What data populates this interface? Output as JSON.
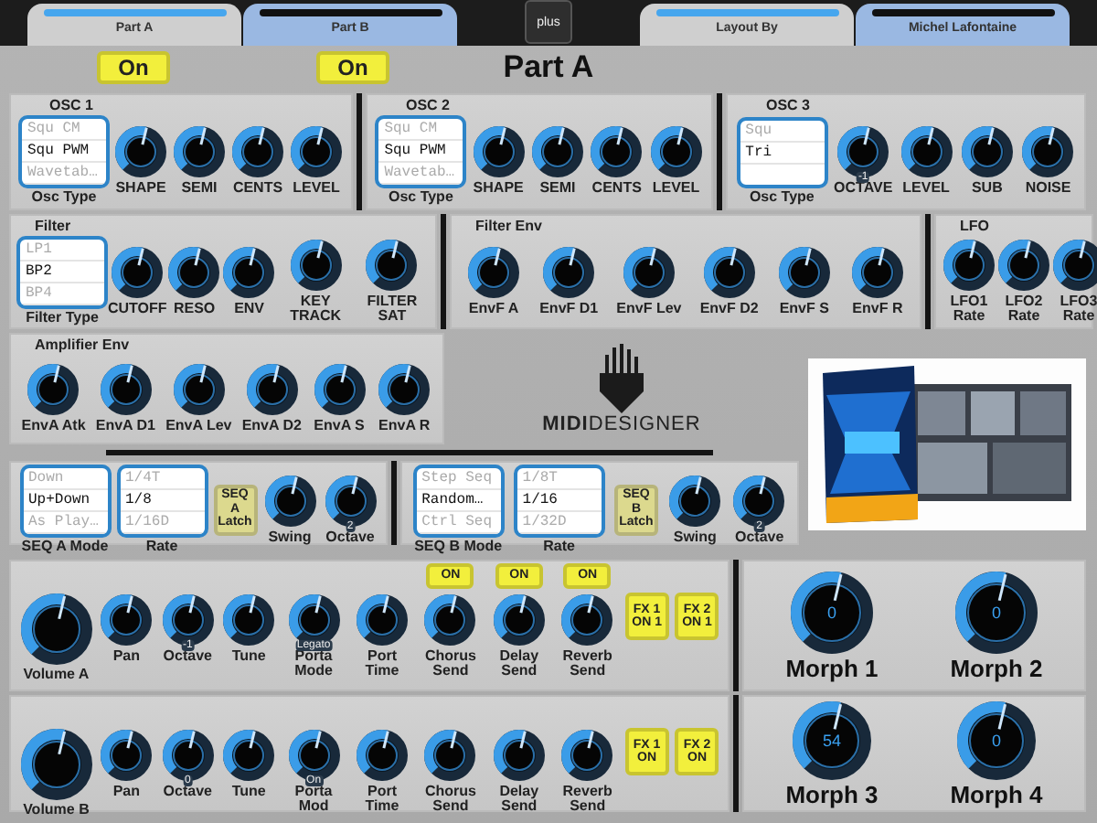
{
  "top_tabs": [
    {
      "label": "Part A",
      "lit": true
    },
    {
      "label": "Part B",
      "lit": false
    }
  ],
  "plus_button": "plus",
  "info_tabs": [
    {
      "label": "Layout By",
      "lit": true
    },
    {
      "label": "Michel Lafontaine",
      "lit": false
    }
  ],
  "part_switches": [
    {
      "label": "On",
      "on": true
    },
    {
      "label": "On",
      "on": true
    }
  ],
  "title": "Part A",
  "oscillators": [
    {
      "title": "OSC 1",
      "controls": [
        {
          "kind": "list",
          "label": "Osc Type",
          "options": [
            {
              "text": "Squ CM",
              "selected": false
            },
            {
              "text": "Squ PWM",
              "selected": true
            },
            {
              "text": "Wavetab…",
              "selected": false
            }
          ]
        },
        {
          "kind": "knob",
          "label": "SHAPE"
        },
        {
          "kind": "knob",
          "label": "SEMI"
        },
        {
          "kind": "knob",
          "label": "CENTS"
        },
        {
          "kind": "knob",
          "label": "LEVEL"
        }
      ]
    },
    {
      "title": "OSC 2",
      "controls": [
        {
          "kind": "list",
          "label": "Osc Type",
          "options": [
            {
              "text": "Squ CM",
              "selected": false
            },
            {
              "text": "Squ PWM",
              "selected": true
            },
            {
              "text": "Wavetab…",
              "selected": false
            }
          ]
        },
        {
          "kind": "knob",
          "label": "SHAPE"
        },
        {
          "kind": "knob",
          "label": "SEMI"
        },
        {
          "kind": "knob",
          "label": "CENTS"
        },
        {
          "kind": "knob",
          "label": "LEVEL"
        }
      ]
    },
    {
      "title": "OSC 3",
      "controls": [
        {
          "kind": "list",
          "label": "Osc Type",
          "options": [
            {
              "text": "Squ",
              "selected": false
            },
            {
              "text": "Tri",
              "selected": true
            }
          ]
        },
        {
          "kind": "knob",
          "label": "OCTAVE",
          "badge": "-1"
        },
        {
          "kind": "knob",
          "label": "LEVEL"
        },
        {
          "kind": "knob",
          "label": "SUB"
        },
        {
          "kind": "knob",
          "label": "NOISE"
        }
      ]
    }
  ],
  "filters": [
    {
      "title": "Filter",
      "controls": [
        {
          "kind": "list",
          "label": "Filter Type",
          "options": [
            {
              "text": "LP1",
              "selected": false
            },
            {
              "text": "BP2",
              "selected": true
            },
            {
              "text": "BP4",
              "selected": false
            }
          ]
        },
        {
          "kind": "knob",
          "label": "CUTOFF"
        },
        {
          "kind": "knob",
          "label": "RESO"
        },
        {
          "kind": "knob",
          "label": "ENV"
        },
        {
          "kind": "knob",
          "label": "KEY TRACK"
        },
        {
          "kind": "knob",
          "label": "FILTER SAT"
        }
      ]
    },
    {
      "title": "Filter Env",
      "controls": [
        {
          "kind": "knob",
          "label": "EnvF A"
        },
        {
          "kind": "knob",
          "label": "EnvF D1"
        },
        {
          "kind": "knob",
          "label": "EnvF Lev"
        },
        {
          "kind": "knob",
          "label": "EnvF D2"
        },
        {
          "kind": "knob",
          "label": "EnvF S"
        },
        {
          "kind": "knob",
          "label": "EnvF R"
        }
      ]
    },
    {
      "title": "LFO",
      "controls": [
        {
          "kind": "knob",
          "label": "LFO1 Rate"
        },
        {
          "kind": "knob",
          "label": "LFO2 Rate"
        },
        {
          "kind": "knob",
          "label": "LFO3 Rate"
        }
      ]
    }
  ],
  "amp_env": {
    "title": "Amplifier Env",
    "controls": [
      {
        "kind": "knob",
        "label": "EnvA Atk"
      },
      {
        "kind": "knob",
        "label": "EnvA D1"
      },
      {
        "kind": "knob",
        "label": "EnvA Lev"
      },
      {
        "kind": "knob",
        "label": "EnvA D2"
      },
      {
        "kind": "knob",
        "label": "EnvA S"
      },
      {
        "kind": "knob",
        "label": "EnvA R"
      }
    ]
  },
  "logo": {
    "text": "**MIDI**DESIGNER"
  },
  "sequencers": [
    {
      "controls": [
        {
          "kind": "list",
          "label": "SEQ A Mode",
          "options": [
            {
              "text": "Down",
              "selected": false
            },
            {
              "text": "Up+Down",
              "selected": true
            },
            {
              "text": "As Play…",
              "selected": false
            }
          ]
        },
        {
          "kind": "list",
          "label": "Rate",
          "options": [
            {
              "text": "1/4T",
              "selected": false
            },
            {
              "text": "1/8",
              "selected": true
            },
            {
              "text": "1/16D",
              "selected": false
            }
          ]
        },
        {
          "kind": "toggle",
          "label": "SEQ A Latch",
          "on": false
        },
        {
          "kind": "knob",
          "label": "Swing"
        },
        {
          "kind": "knob",
          "label": "Octave",
          "badge": "2"
        }
      ]
    },
    {
      "controls": [
        {
          "kind": "list",
          "label": "SEQ B Mode",
          "options": [
            {
              "text": "Step Seq",
              "selected": false
            },
            {
              "text": "Random…",
              "selected": true
            },
            {
              "text": "Ctrl Seq",
              "selected": false
            }
          ]
        },
        {
          "kind": "list",
          "label": "Rate",
          "options": [
            {
              "text": "1/8T",
              "selected": false
            },
            {
              "text": "1/16",
              "selected": true
            },
            {
              "text": "1/32D",
              "selected": false
            }
          ]
        },
        {
          "kind": "toggle",
          "label": "SEQ B Latch",
          "on": false
        },
        {
          "kind": "knob",
          "label": "Swing"
        },
        {
          "kind": "knob",
          "label": "Octave",
          "badge": "2"
        }
      ]
    }
  ],
  "voices": [
    {
      "voice": {
        "controls": [
          {
            "kind": "volume",
            "label": "Volume A"
          },
          {
            "kind": "knob",
            "label": "Pan"
          },
          {
            "kind": "knob",
            "label": "Octave",
            "badge": "-1"
          },
          {
            "kind": "knob",
            "label": "Tune"
          },
          {
            "kind": "knob",
            "label": "Porta Mode",
            "badge": "Legato"
          },
          {
            "kind": "knob",
            "label": "Port Time"
          },
          {
            "kind": "knob",
            "label": "Chorus Send",
            "switch": {
              "label": "ON",
              "on": true
            }
          },
          {
            "kind": "knob",
            "label": "Delay Send",
            "switch": {
              "label": "ON",
              "on": true
            }
          },
          {
            "kind": "knob",
            "label": "Reverb Send",
            "switch": {
              "label": "ON",
              "on": true
            }
          },
          {
            "kind": "toggle",
            "label": "FX 1 ON 1",
            "on": true
          },
          {
            "kind": "toggle",
            "label": "FX 2 ON 1",
            "on": true
          }
        ]
      },
      "morphs": [
        {
          "label": "Morph 1",
          "value": "0"
        },
        {
          "label": "Morph 2",
          "value": "0"
        }
      ]
    },
    {
      "voice": {
        "controls": [
          {
            "kind": "volume",
            "label": "Volume B"
          },
          {
            "kind": "knob",
            "label": "Pan"
          },
          {
            "kind": "knob",
            "label": "Octave",
            "badge": "0"
          },
          {
            "kind": "knob",
            "label": "Tune"
          },
          {
            "kind": "knob",
            "label": "Porta Mod",
            "badge": "On"
          },
          {
            "kind": "knob",
            "label": "Port Time"
          },
          {
            "kind": "knob",
            "label": "Chorus Send"
          },
          {
            "kind": "knob",
            "label": "Delay Send"
          },
          {
            "kind": "knob",
            "label": "Reverb Send"
          },
          {
            "kind": "toggle",
            "label": "FX 1 ON",
            "on": true
          },
          {
            "kind": "toggle",
            "label": "FX 2 ON",
            "on": true
          }
        ]
      },
      "morphs": [
        {
          "label": "Morph 3",
          "value": "54"
        },
        {
          "label": "Morph 4",
          "value": "0"
        }
      ]
    }
  ]
}
